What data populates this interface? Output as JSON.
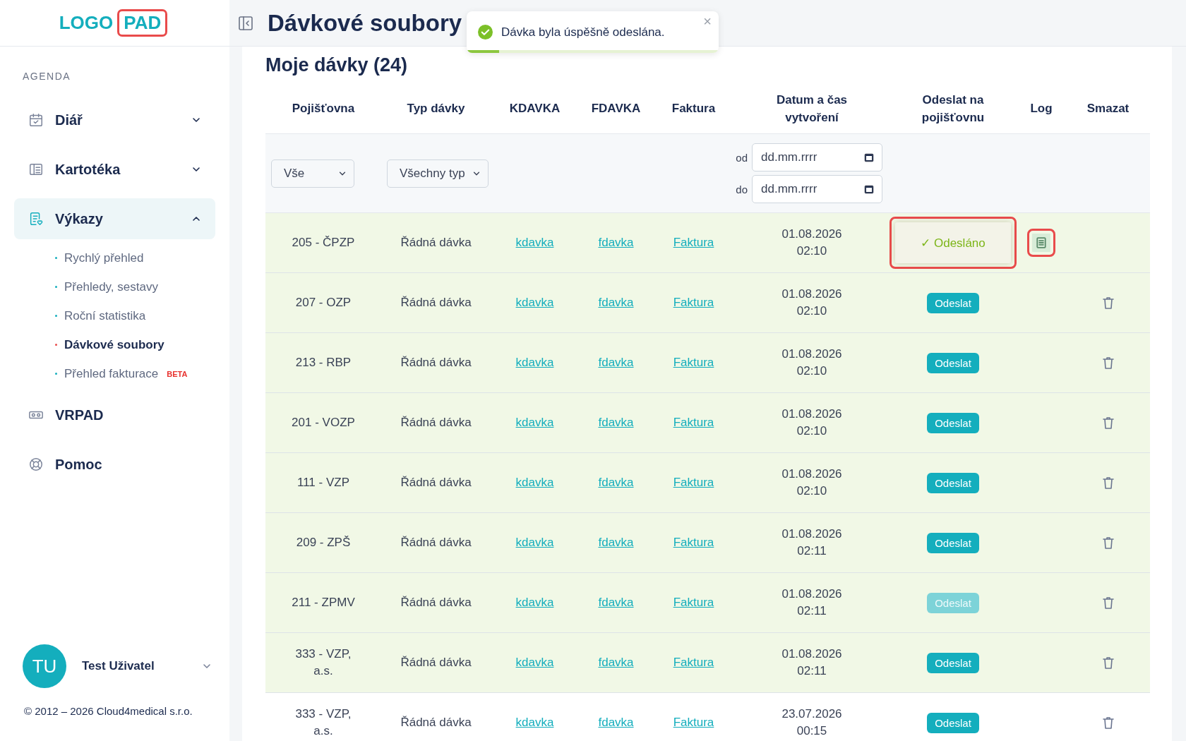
{
  "logo": {
    "text": "LOGO",
    "boxed": "PAD"
  },
  "sidebar": {
    "section": "AGENDA",
    "items": [
      {
        "label": "Diář",
        "expandable": true,
        "expanded": false,
        "selected": false
      },
      {
        "label": "Kartotéka",
        "expandable": true,
        "expanded": false,
        "selected": false
      },
      {
        "label": "Výkazy",
        "expandable": true,
        "expanded": true,
        "selected": true,
        "children": [
          {
            "label": "Rychlý přehled",
            "selected": false
          },
          {
            "label": "Přehledy, sestavy",
            "selected": false
          },
          {
            "label": "Roční statistika",
            "selected": false
          },
          {
            "label": "Dávkové soubory",
            "selected": true
          },
          {
            "label": "Přehled fakturace",
            "selected": false,
            "badge": "BETA"
          }
        ]
      },
      {
        "label": "VRPAD",
        "expandable": false,
        "selected": false
      },
      {
        "label": "Pomoc",
        "expandable": false,
        "selected": false
      }
    ],
    "user": {
      "initials": "TU",
      "name": "Test Uživatel"
    },
    "copyright": "© 2012 – 2026 Cloud4medical s.r.o."
  },
  "header": {
    "title": "Dávkové soubory"
  },
  "toast": {
    "message": "Dávka byla úspěšně odeslána.",
    "close": "×",
    "level": 0.13
  },
  "section_title": "Moje dávky (24)",
  "table": {
    "columns": [
      "Pojišťovna",
      "Typ dávky",
      "KDAVKA",
      "FDAVKA",
      "Faktura",
      "Datum a čas vytvoření",
      "Odeslat na pojišťovnu",
      "Log",
      "Smazat"
    ],
    "filters": {
      "insurer": "Vše",
      "type": "Všechny typ",
      "from_label": "od",
      "to_label": "do",
      "from_placeholder": "dd.mm.rrrr",
      "to_placeholder": "dd.mm.rrrr"
    },
    "rows": [
      {
        "insurer": "205 - ČPZP",
        "type": "Řádná dávka",
        "kdavka": "kdavka",
        "fdavka": "fdavka",
        "invoice": "Faktura",
        "date": "01.08.2026",
        "time": "02:10",
        "status": {
          "kind": "sent",
          "label": "✓ Odesláno",
          "disabled": false
        },
        "marked": true,
        "log": true,
        "deletable": false,
        "tinted": true
      },
      {
        "insurer": "207 - OZP",
        "type": "Řádná dávka",
        "kdavka": "kdavka",
        "fdavka": "fdavka",
        "invoice": "Faktura",
        "date": "01.08.2026",
        "time": "02:10",
        "status": {
          "kind": "button",
          "label": "Odeslat",
          "disabled": false
        },
        "marked": false,
        "log": false,
        "deletable": true,
        "tinted": true
      },
      {
        "insurer": "213 - RBP",
        "type": "Řádná dávka",
        "kdavka": "kdavka",
        "fdavka": "fdavka",
        "invoice": "Faktura",
        "date": "01.08.2026",
        "time": "02:10",
        "status": {
          "kind": "button",
          "label": "Odeslat",
          "disabled": false
        },
        "marked": false,
        "log": false,
        "deletable": true,
        "tinted": true
      },
      {
        "insurer": "201 - VOZP",
        "type": "Řádná dávka",
        "kdavka": "kdavka",
        "fdavka": "fdavka",
        "invoice": "Faktura",
        "date": "01.08.2026",
        "time": "02:10",
        "status": {
          "kind": "button",
          "label": "Odeslat",
          "disabled": false
        },
        "marked": false,
        "log": false,
        "deletable": true,
        "tinted": true
      },
      {
        "insurer": "111 - VZP",
        "type": "Řádná dávka",
        "kdavka": "kdavka",
        "fdavka": "fdavka",
        "invoice": "Faktura",
        "date": "01.08.2026",
        "time": "02:10",
        "status": {
          "kind": "button",
          "label": "Odeslat",
          "disabled": false
        },
        "marked": false,
        "log": false,
        "deletable": true,
        "tinted": true
      },
      {
        "insurer": "209 - ZPŠ",
        "type": "Řádná dávka",
        "kdavka": "kdavka",
        "fdavka": "fdavka",
        "invoice": "Faktura",
        "date": "01.08.2026",
        "time": "02:11",
        "status": {
          "kind": "button",
          "label": "Odeslat",
          "disabled": false
        },
        "marked": false,
        "log": false,
        "deletable": true,
        "tinted": true
      },
      {
        "insurer": "211 - ZPMV",
        "type": "Řádná dávka",
        "kdavka": "kdavka",
        "fdavka": "fdavka",
        "invoice": "Faktura",
        "date": "01.08.2026",
        "time": "02:11",
        "status": {
          "kind": "button",
          "label": "Odeslat",
          "disabled": true
        },
        "marked": false,
        "log": false,
        "deletable": true,
        "tinted": true
      },
      {
        "insurer": "333 - VZP, a.s.",
        "type": "Řádná dávka",
        "kdavka": "kdavka",
        "fdavka": "fdavka",
        "invoice": "Faktura",
        "date": "01.08.2026",
        "time": "02:11",
        "status": {
          "kind": "button",
          "label": "Odeslat",
          "disabled": false
        },
        "marked": false,
        "log": false,
        "deletable": true,
        "tinted": true
      },
      {
        "insurer": "333 - VZP, a.s.",
        "type": "Řádná dávka",
        "kdavka": "kdavka",
        "fdavka": "fdavka",
        "invoice": "Faktura",
        "date": "23.07.2026",
        "time": "00:15",
        "status": {
          "kind": "button",
          "label": "Odeslat",
          "disabled": false
        },
        "marked": false,
        "log": false,
        "deletable": true,
        "tinted": false
      }
    ]
  }
}
